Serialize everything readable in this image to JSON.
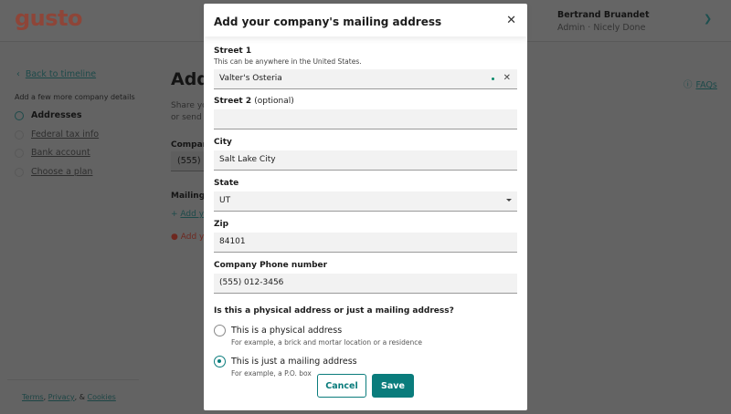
{
  "header": {
    "logo": "gusto",
    "user_name": "Bertrand Bruandet",
    "user_role": "Admin · Nicely Done"
  },
  "sidebar": {
    "back": "Back to timeline",
    "heading": "Add a few more company details",
    "steps": [
      {
        "label": "Addresses",
        "active": true
      },
      {
        "label": "Federal tax info"
      },
      {
        "label": "Bank account"
      },
      {
        "label": "Choose a plan"
      }
    ]
  },
  "page": {
    "title": "Add",
    "desc1": "Share yo",
    "desc2": "or send y",
    "phone_label": "Compan",
    "phone_value": "(555) 0",
    "mailing_label": "Mailing",
    "add_link": "Add y",
    "error": "Add yo",
    "faqs": "FAQs"
  },
  "footer": {
    "terms": "Terms",
    "privacy": "Privacy",
    "cookies": "Cookies",
    "amp": ", & ",
    "comma": ", "
  },
  "modal": {
    "title": "Add your company's mailing address",
    "street1": {
      "label": "Street 1",
      "hint": "This can be anywhere in the United States.",
      "value": "Valter's Osteria"
    },
    "street2": {
      "label": "Street 2",
      "optional": "(optional)",
      "value": ""
    },
    "city": {
      "label": "City",
      "value": "Salt Lake City"
    },
    "state": {
      "label": "State",
      "value": "UT"
    },
    "zip": {
      "label": "Zip",
      "value": "84101"
    },
    "phone": {
      "label": "Company Phone number",
      "value": "(555) 012-3456"
    },
    "question": "Is this a physical address or just a mailing address?",
    "options": [
      {
        "label": "This is a physical address",
        "sub": "For example, a brick and mortar location or a residence",
        "selected": false
      },
      {
        "label": "This is just a mailing address",
        "sub": "For example, a P.O. box",
        "selected": true
      }
    ],
    "cancel": "Cancel",
    "save": "Save"
  }
}
